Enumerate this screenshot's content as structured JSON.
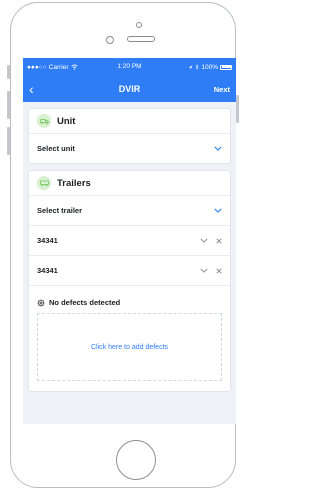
{
  "status_bar": {
    "carrier": "Carrier",
    "time": "1:20 PM",
    "battery": "100%"
  },
  "nav": {
    "title": "DVIR",
    "next_label": "Next"
  },
  "unit": {
    "title": "Unit",
    "select_label": "Select unit"
  },
  "trailers": {
    "title": "Trailers",
    "select_label": "Select trailer",
    "items": [
      {
        "id": "34341"
      },
      {
        "id": "34341"
      }
    ]
  },
  "defects": {
    "status": "No defects detected",
    "add_label": "Click here to add defects"
  },
  "colors": {
    "accent": "#2e7cf6",
    "icon_bg": "#d9f0d2",
    "icon_fg": "#6cc257"
  }
}
